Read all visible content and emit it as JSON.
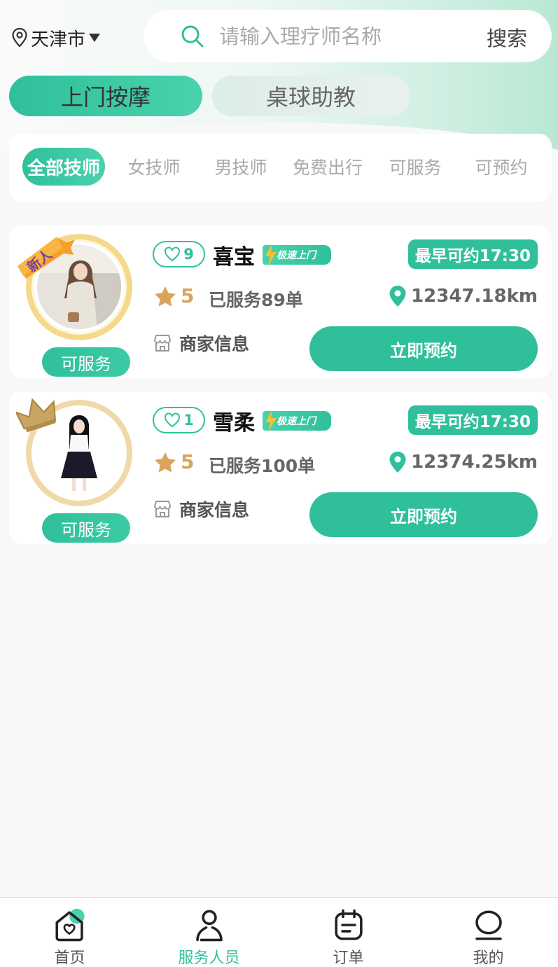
{
  "location": {
    "city": "天津市"
  },
  "search": {
    "placeholder": "请输入理疗师名称",
    "button_label": "搜索"
  },
  "category_tabs": [
    {
      "label": "上门按摩",
      "active": true
    },
    {
      "label": "桌球助教",
      "active": false
    }
  ],
  "filters": [
    {
      "label": "全部技师",
      "active": true
    },
    {
      "label": "女技师",
      "active": false
    },
    {
      "label": "男技师",
      "active": false
    },
    {
      "label": "免费出行",
      "active": false
    },
    {
      "label": "可服务",
      "active": false
    },
    {
      "label": "可预约",
      "active": false
    }
  ],
  "therapists": [
    {
      "name": "喜宝",
      "likes": "9",
      "badge": "极速上门",
      "avatar_tag": "新人",
      "earliest": "最早可约17:30",
      "rating": "5",
      "served": "已服务89单",
      "distance": "12347.18km",
      "merchant": "商家信息",
      "status": "可服务",
      "book_label": "立即预约"
    },
    {
      "name": "雪柔",
      "likes": "1",
      "badge": "极速上门",
      "earliest": "最早可约17:30",
      "rating": "5",
      "served": "已服务100单",
      "distance": "12374.25km",
      "merchant": "商家信息",
      "status": "可服务",
      "book_label": "立即预约"
    }
  ],
  "tabbar": [
    {
      "label": "首页",
      "icon": "home-icon",
      "active": false
    },
    {
      "label": "服务人员",
      "icon": "person-icon",
      "active": true
    },
    {
      "label": "订单",
      "icon": "order-icon",
      "active": false
    },
    {
      "label": "我的",
      "icon": "profile-icon",
      "active": false
    }
  ],
  "colors": {
    "accent": "#2fc09b",
    "rating": "#d9a45d",
    "background": "#f8f8f8"
  }
}
